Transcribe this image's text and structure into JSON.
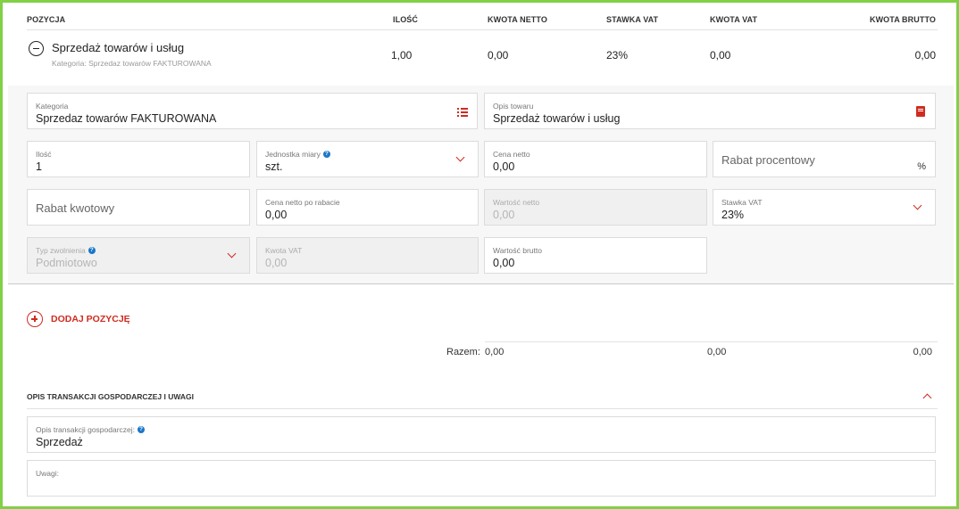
{
  "table": {
    "headers": {
      "position": "POZYCJA",
      "quantity": "ILOŚĆ",
      "net_amount": "KWOTA NETTO",
      "vat_rate": "STAWKA VAT",
      "vat_amount": "KWOTA VAT",
      "gross_amount": "KWOTA BRUTTO"
    },
    "row": {
      "name": "Sprzedaż towarów i usług",
      "category_line": "Kategoria: Sprzedaz towarów FAKTUROWANA",
      "quantity": "1,00",
      "net_amount": "0,00",
      "vat_rate": "23%",
      "vat_amount": "0,00",
      "gross_amount": "0,00"
    }
  },
  "form": {
    "category": {
      "label": "Kategoria",
      "value": "Sprzedaz towarów FAKTUROWANA"
    },
    "description": {
      "label": "Opis towaru",
      "value": "Sprzedaż towarów i usług"
    },
    "quantity": {
      "label": "Ilość",
      "value": "1"
    },
    "unit": {
      "label": "Jednostka miary",
      "value": "szt."
    },
    "net_price": {
      "label": "Cena netto",
      "value": "0,00"
    },
    "discount_percent": {
      "placeholder": "Rabat procentowy",
      "suffix": "%"
    },
    "discount_amount": {
      "placeholder": "Rabat kwotowy"
    },
    "net_after_discount": {
      "label": "Cena netto po rabacie",
      "value": "0,00"
    },
    "net_value": {
      "label": "Wartość netto",
      "value": "0,00"
    },
    "vat_rate": {
      "label": "Stawka VAT",
      "value": "23%"
    },
    "exemption_type": {
      "label": "Typ zwolnienia",
      "value": "Podmiotowo"
    },
    "vat_amount": {
      "label": "Kwota VAT",
      "value": "0,00"
    },
    "gross_value": {
      "label": "Wartość brutto",
      "value": "0,00"
    }
  },
  "add_position": {
    "label": "DODAJ POZYCJĘ"
  },
  "totals": {
    "label": "Razem:",
    "net": "0,00",
    "vat": "0,00",
    "gross": "0,00"
  },
  "notes_section": {
    "title": "OPIS TRANSAKCJI GOSPODARCZEJ I UWAGI",
    "transaction_label": "Opis transakcji gospodarczej:",
    "transaction_value": "Sprzedaż",
    "remarks_label": "Uwagi:",
    "remarks_value": ""
  },
  "colors": {
    "accent": "#d02b20",
    "frame": "#82d045",
    "info": "#1a77c9"
  }
}
